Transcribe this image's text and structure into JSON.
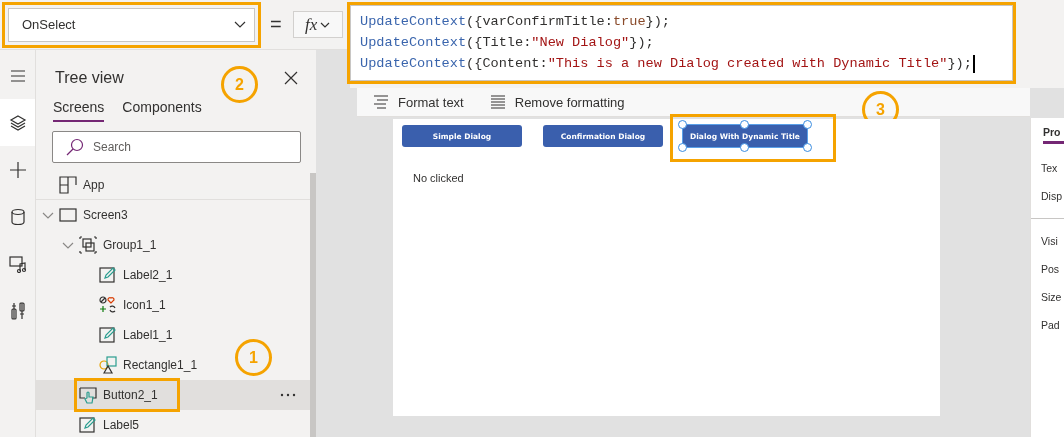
{
  "property_selector": {
    "value": "OnSelect",
    "highlighted": true
  },
  "equals": "=",
  "fx_button": {
    "label": "fx"
  },
  "formula": {
    "highlighted": true,
    "cursor": true,
    "lines": [
      [
        {
          "kind": "function",
          "text": "UpdateContext"
        },
        {
          "kind": "plain",
          "text": "({varConfirmTitle:"
        },
        {
          "kind": "boolean",
          "text": "true"
        },
        {
          "kind": "plain",
          "text": "});"
        }
      ],
      [
        {
          "kind": "function",
          "text": "UpdateContext"
        },
        {
          "kind": "plain",
          "text": "({Title:"
        },
        {
          "kind": "string",
          "text": "\"New Dialog\""
        },
        {
          "kind": "plain",
          "text": "});"
        }
      ],
      [
        {
          "kind": "function",
          "text": "UpdateContext"
        },
        {
          "kind": "plain",
          "text": "({Content:"
        },
        {
          "kind": "string",
          "text": "\"This is a new Dialog created with Dynamic Title\""
        },
        {
          "kind": "plain",
          "text": "});"
        }
      ]
    ]
  },
  "format_bar": {
    "marker": "3",
    "buttons": [
      {
        "kind": "format",
        "label": "Format text"
      },
      {
        "kind": "remove",
        "label": "Remove formatting"
      }
    ]
  },
  "rail": [
    {
      "kind": "menu",
      "selected": false
    },
    {
      "kind": "layers",
      "selected": true
    },
    {
      "kind": "insert",
      "selected": false
    },
    {
      "kind": "data",
      "selected": false
    },
    {
      "kind": "media",
      "selected": false
    },
    {
      "kind": "tools",
      "selected": false
    }
  ],
  "tree_view": {
    "title": "Tree view",
    "marker": "2",
    "tabs": [
      {
        "label": "Screens",
        "selected": true
      },
      {
        "label": "Components",
        "selected": false
      }
    ],
    "search": {
      "placeholder": "Search"
    },
    "items": [
      {
        "label": "App",
        "kind": "app",
        "selected": false
      },
      {
        "label": "Screen3",
        "kind": "screen",
        "selected": false,
        "expanded": true,
        "children": [
          {
            "label": "Group1_1",
            "kind": "group",
            "selected": false,
            "expanded": true,
            "children": [
              {
                "label": "Label2_1",
                "kind": "label",
                "selected": false
              },
              {
                "label": "Icon1_1",
                "kind": "icon",
                "selected": false
              },
              {
                "label": "Label1_1",
                "kind": "label",
                "selected": false
              },
              {
                "label": "Rectangle1_1",
                "kind": "rectangle",
                "selected": false,
                "marker": "1"
              }
            ]
          },
          {
            "label": "Button2_1",
            "kind": "button",
            "selected": true,
            "highlighted": true
          },
          {
            "label": "Label5",
            "kind": "label",
            "selected": false
          }
        ]
      }
    ]
  },
  "canvas": {
    "buttons": [
      {
        "label": "Simple Dialog",
        "selected": false,
        "highlighted": false
      },
      {
        "label": "Confirmation Dialog",
        "selected": false,
        "highlighted": false
      },
      {
        "label": "Dialog With Dynamic Title",
        "selected": true,
        "highlighted": true
      }
    ],
    "label": "No clicked"
  },
  "properties_panel": {
    "tab": {
      "label": "Pro",
      "selected": true
    },
    "sections": [
      {
        "rows": [
          {
            "label": "Tex"
          },
          {
            "label": "Disp"
          }
        ]
      },
      {
        "rows": [
          {
            "label": "Visi"
          },
          {
            "label": "Pos"
          },
          {
            "label": "Size"
          },
          {
            "label": "Pad"
          }
        ]
      }
    ]
  }
}
